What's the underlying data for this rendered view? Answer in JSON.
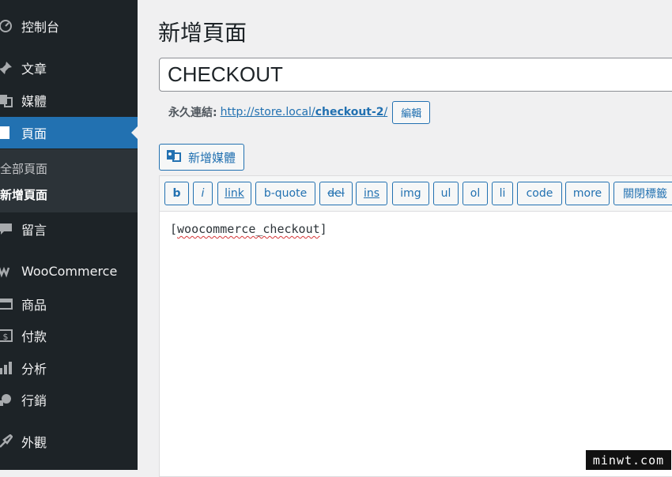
{
  "sidebar": {
    "items": [
      {
        "icon": "dashboard-icon",
        "label": "控制台"
      },
      {
        "icon": "pin-icon",
        "label": "文章"
      },
      {
        "icon": "media-icon",
        "label": "媒體"
      },
      {
        "icon": "page-icon",
        "label": "頁面"
      },
      {
        "icon": "comment-icon",
        "label": "留言"
      },
      {
        "icon": "woocommerce-icon",
        "label": "WooCommerce"
      },
      {
        "icon": "products-icon",
        "label": "商品"
      },
      {
        "icon": "payments-icon",
        "label": "付款"
      },
      {
        "icon": "analytics-icon",
        "label": "分析"
      },
      {
        "icon": "marketing-icon",
        "label": "行銷"
      },
      {
        "icon": "appearance-icon",
        "label": "外觀"
      }
    ],
    "submenu": [
      "全部頁面",
      "新增頁面"
    ],
    "current_item": "頁面",
    "accent_color": "#2271b1"
  },
  "main": {
    "page_title": "新增頁面",
    "title_value": "CHECKOUT",
    "permalink": {
      "label": "永久連結:",
      "url_base": "http://store.local/",
      "url_slug": "checkout-2",
      "url_trailing": "/",
      "edit_button": "編輯"
    },
    "add_media_button": "新增媒體",
    "quicktags": [
      "b",
      "i",
      "link",
      "b-quote",
      "del",
      "ins",
      "img",
      "ul",
      "ol",
      "li",
      "code",
      "more",
      "關閉標籤"
    ],
    "editor": {
      "open_bracket": "[",
      "shortcode": "woocommerce_checkout",
      "close_bracket": "]"
    }
  },
  "watermark": "minwt.com"
}
